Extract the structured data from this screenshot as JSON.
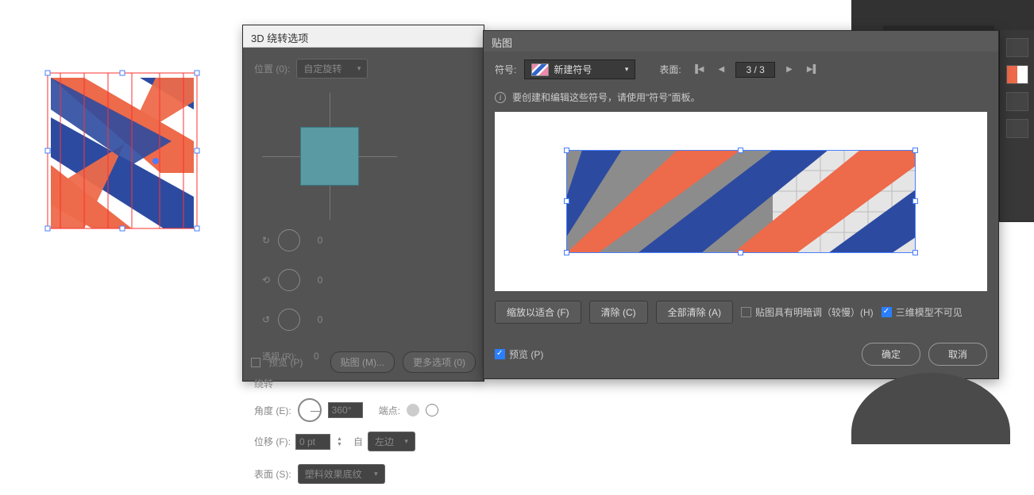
{
  "panel3d": {
    "title": "3D 绕转选项",
    "position_label": "位置 (0):",
    "position_value": "自定旋转",
    "angle_values": [
      "0",
      "0",
      "0"
    ],
    "perspective_label": "透视 (R):",
    "perspective_value": "0",
    "revolve_section": "绕转",
    "angle_label": "角度 (E):",
    "angle_value": "360°",
    "cap_label": "端点:",
    "offset_label": "位移 (F):",
    "offset_value": "0 pt",
    "from_label": "自",
    "from_value": "左边",
    "surface_label": "表面 (S):",
    "surface_value": "塑料效果底纹",
    "preview_label": "预览 (P)",
    "map_art_btn": "贴图 (M)...",
    "more_options_btn": "更多选项 (0)"
  },
  "panelmap": {
    "title": "贴图",
    "symbol_label": "符号:",
    "symbol_value": "新建符号",
    "surface_label": "表面:",
    "surface_count": "3 / 3",
    "info_text": "要创建和编辑这些符号，请使用\"符号\"面板。",
    "scale_to_fit": "缩放以适合 (F)",
    "clear": "清除 (C)",
    "clear_all": "全部清除 (A)",
    "shade_label": "贴图具有明暗调（较慢）(H)",
    "invisible_label": "三维模型不可见",
    "preview_label": "预览 (P)",
    "ok_btn": "确定",
    "cancel_btn": "取消"
  },
  "colors": {
    "orange": "#ed6a4a",
    "blue": "#2c4ba0",
    "teal": "#5a9aa3",
    "gray": "#8c8c8c",
    "lightgray": "#e5e5e5"
  }
}
